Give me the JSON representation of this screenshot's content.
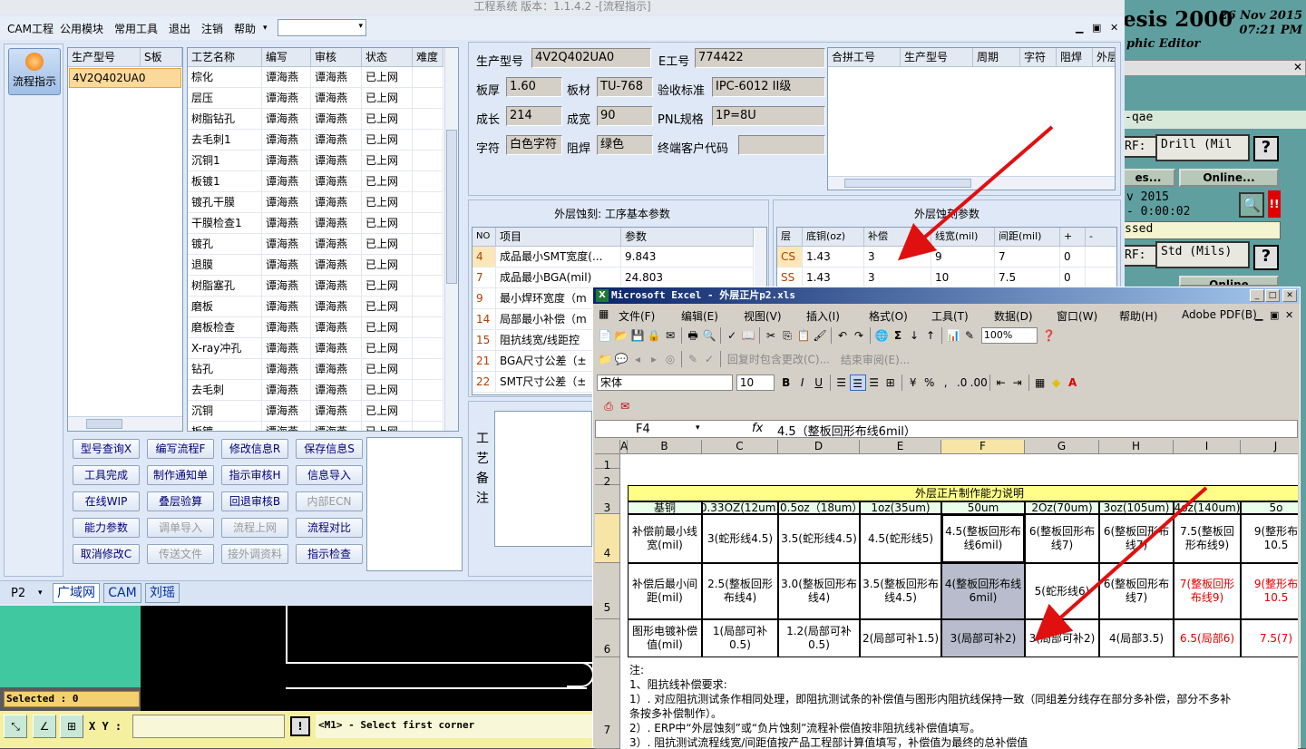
{
  "app": {
    "title": "工程系统 版本：1.1.4.2 -[流程指示]",
    "menus": [
      "CAM工程",
      "公用模块",
      "常用工具",
      "退出",
      "注销",
      "帮助"
    ],
    "left_nav": "流程指示"
  },
  "model_list": {
    "headers": [
      "生产型号",
      "S板"
    ],
    "rows": [
      "4V2Q402UA0"
    ]
  },
  "process": {
    "headers": [
      "工艺名称",
      "编写",
      "审核",
      "状态",
      "难度"
    ],
    "rows": [
      [
        "棕化",
        "谭海燕",
        "谭海燕",
        "已上网"
      ],
      [
        "层压",
        "谭海燕",
        "谭海燕",
        "已上网"
      ],
      [
        "树脂钻孔",
        "谭海燕",
        "谭海燕",
        "已上网"
      ],
      [
        "去毛刺1",
        "谭海燕",
        "谭海燕",
        "已上网"
      ],
      [
        "沉铜1",
        "谭海燕",
        "谭海燕",
        "已上网"
      ],
      [
        "板镀1",
        "谭海燕",
        "谭海燕",
        "已上网"
      ],
      [
        "镀孔干膜",
        "谭海燕",
        "谭海燕",
        "已上网"
      ],
      [
        "干膜检查1",
        "谭海燕",
        "谭海燕",
        "已上网"
      ],
      [
        "镀孔",
        "谭海燕",
        "谭海燕",
        "已上网"
      ],
      [
        "退膜",
        "谭海燕",
        "谭海燕",
        "已上网"
      ],
      [
        "树脂塞孔",
        "谭海燕",
        "谭海燕",
        "已上网"
      ],
      [
        "磨板",
        "谭海燕",
        "谭海燕",
        "已上网"
      ],
      [
        "磨板检查",
        "谭海燕",
        "谭海燕",
        "已上网"
      ],
      [
        "X-ray冲孔",
        "谭海燕",
        "谭海燕",
        "已上网"
      ],
      [
        "钻孔",
        "谭海燕",
        "谭海燕",
        "已上网"
      ],
      [
        "去毛刺",
        "谭海燕",
        "谭海燕",
        "已上网"
      ],
      [
        "沉铜",
        "谭海燕",
        "谭海燕",
        "已上网"
      ],
      [
        "板镀",
        "谭海燕",
        "谭海燕",
        "已上网"
      ]
    ]
  },
  "buttons": [
    [
      "型号查询X",
      "编写流程F",
      "修改信息R",
      "保存信息S"
    ],
    [
      "工具完成",
      "制作通知单",
      "指示审核H",
      "信息导入"
    ],
    [
      "在线WIP",
      "叠层验算",
      "回退审核B",
      "内部ECN"
    ],
    [
      "能力参数",
      "调单导入",
      "流程上网",
      "流程对比"
    ],
    [
      "取消修改C",
      "传送文件",
      "接外调资料",
      "指示检查"
    ]
  ],
  "info": {
    "model_lbl": "生产型号",
    "model": "4V2Q402UA0",
    "eno_lbl": "E工号",
    "eno": "774422",
    "thick_lbl": "板厚",
    "thick": "1.60",
    "mat_lbl": "板材",
    "mat": "TU-768",
    "std_lbl": "验收标准",
    "std": "IPC-6012 II级",
    "len_lbl": "成长",
    "len": "214",
    "wid_lbl": "成宽",
    "wid": "90",
    "pnl_lbl": "PNL规格",
    "pnl": "1P=8U",
    "char_lbl": "字符",
    "char": "白色字符",
    "mask_lbl": "阻焊",
    "mask": "绿色",
    "cust_lbl": "终端客户代码"
  },
  "merge": {
    "headers": [
      "合拼工号",
      "生产型号",
      "周期",
      "字符",
      "阻焊",
      "外层"
    ]
  },
  "params": {
    "title": "外层蚀刻: 工序基本参数",
    "headers": [
      "NO",
      "项目",
      "参数"
    ],
    "rows": [
      [
        "4",
        "成品最小SMT宽度(...",
        "9.843"
      ],
      [
        "7",
        "成品最小BGA(mil)",
        "24.803"
      ],
      [
        "9",
        "最小焊环宽度（m",
        ""
      ],
      [
        "14",
        "局部最小补偿（m",
        ""
      ],
      [
        "15",
        "阻抗线宽/线距控",
        ""
      ],
      [
        "21",
        "BGA尺寸公差（±",
        ""
      ],
      [
        "22",
        "SMT尺寸公差（±",
        ""
      ]
    ]
  },
  "etch": {
    "title": "外层蚀刻参数",
    "headers": [
      "层",
      "底铜(oz)",
      "补偿",
      "线宽(mil)",
      "间距(mil)",
      "+",
      "-"
    ],
    "rows": [
      [
        "CS",
        "1.43",
        "3",
        "9",
        "7",
        "0"
      ],
      [
        "SS",
        "1.43",
        "3",
        "10",
        "7.5",
        "0"
      ]
    ]
  },
  "note_label": "工艺备注",
  "status": {
    "p2": "P2",
    "tabs": [
      "广域网",
      "CAM",
      "刘瑶"
    ]
  },
  "genesis": {
    "title": "esis 2000",
    "date": "26 Nov 2015",
    "time": "07:21 PM",
    "sub": "phic Editor",
    "qae": "-qae",
    "drill": "Drill (Mil",
    "es": "es...",
    "online": "Online...",
    "date2": "v 2015",
    "dur": "- 0:00:02",
    "ssed": "ssed",
    "std": "Std (Mils)",
    "online2": "Online",
    "selected": "Selected : 0",
    "xy": "X Y :",
    "prompt": "<M1> - Select first corner"
  },
  "excel": {
    "title": "Microsoft Excel - 外层正片p2.xls",
    "menus": [
      "文件(F)",
      "编辑(E)",
      "视图(V)",
      "插入(I)",
      "格式(O)",
      "工具(T)",
      "数据(D)",
      "窗口(W)",
      "帮助(H)",
      "Adobe PDF(B)"
    ],
    "zoom": "100%",
    "font": "宋体",
    "size": "10",
    "review": "结束审阅(E)...",
    "reply": "回复时包含更改(C)...",
    "cellref": "F4",
    "formula": "4.5（整板回形布线6mil）",
    "cols": [
      "A",
      "B",
      "C",
      "D",
      "E",
      "F",
      "G",
      "H",
      "I",
      "J"
    ],
    "sheet_title": "外层正片制作能力说明",
    "hdr": [
      "基铜",
      "0.33OZ(12um)",
      "0.5oz（18um）",
      "1oz(35um)",
      "50um",
      "2Oz(70um)",
      "3oz(105um)",
      "4oz(140um)",
      "5o"
    ],
    "r4": [
      "补偿前最小线宽(mil)",
      "3(蛇形线4.5)",
      "3.5(蛇形线4.5)",
      "4.5(蛇形线5)",
      "4.5(整板回形布线6mil)",
      "6(整板回形布线7)",
      "6(整板回形布线7)",
      "7.5(整板回形布线9)",
      "9(整形布10.5"
    ],
    "r5": [
      "补偿后最小间距(mil)",
      "2.5(整板回形布线4)",
      "3.0(整板回形布线4)",
      "3.5(整板回形布线4.5)",
      "4(整板回形布线6mil)",
      "5(蛇形线6)",
      "6(整板回形布线7)",
      "7(整板回形布线9)",
      "9(整形布10.5"
    ],
    "r6": [
      "图形电镀补偿值(mil)",
      "1(局部可补0.5)",
      "1.2(局部可补0.5)",
      "2(局部可补1.5)",
      "3(局部可补2)",
      "3(局部可补2)",
      "4(局部3.5)",
      "6.5(局部6)",
      "7.5(7)"
    ],
    "notes": [
      "注:",
      "1、阻抗线补偿要求:",
      "1）. 对应阻抗测试条作相同处理，即阻抗测试条的补偿值与图形内阻抗线保持一致（同组差分线存在部分多补偿，部分不多补",
      "条按多补偿制作）。",
      "2）. ERP中“外层蚀刻”或“负片蚀刻”流程补偿值按非阻抗线补偿值填写。",
      "3）. 阻抗测试流程线宽/间距值按产品工程部计算值填写，补偿值为最终的总补偿值"
    ]
  }
}
